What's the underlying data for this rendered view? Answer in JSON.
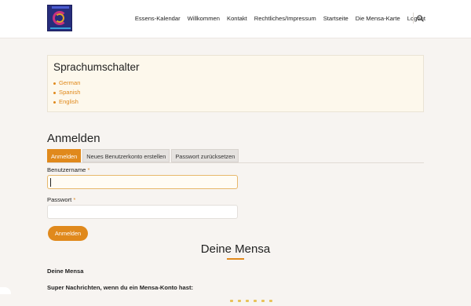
{
  "header": {
    "logo_name": "mensa-logo",
    "nav": [
      "Essens-Kalendar",
      "Willkommen",
      "Kontakt",
      "Rechtliches/Impressum",
      "Startseite",
      "Die Mensa-Karte",
      "Logout"
    ],
    "search_icon": "search-icon"
  },
  "language_box": {
    "title": "Sprachumschalter",
    "languages": [
      "German",
      "Spanish",
      "English"
    ]
  },
  "login": {
    "title": "Anmelden",
    "tabs": [
      "Anmelden",
      "Neues Benutzerkonto erstellen",
      "Passwort zurücksetzen"
    ],
    "username_label": "Benutzername",
    "password_label": "Passwort",
    "required_mark": "*",
    "username_value": "",
    "password_value": "",
    "submit_label": "Anmelden"
  },
  "content": {
    "section_title": "Deine Mensa",
    "subtitle": "Deine Mensa",
    "text": "Super Nachrichten, wenn du ein Mensa-Konto hast:"
  },
  "colors": {
    "accent": "#e0891c",
    "background": "#f7f4f1",
    "box_background": "#fdf8ec"
  }
}
